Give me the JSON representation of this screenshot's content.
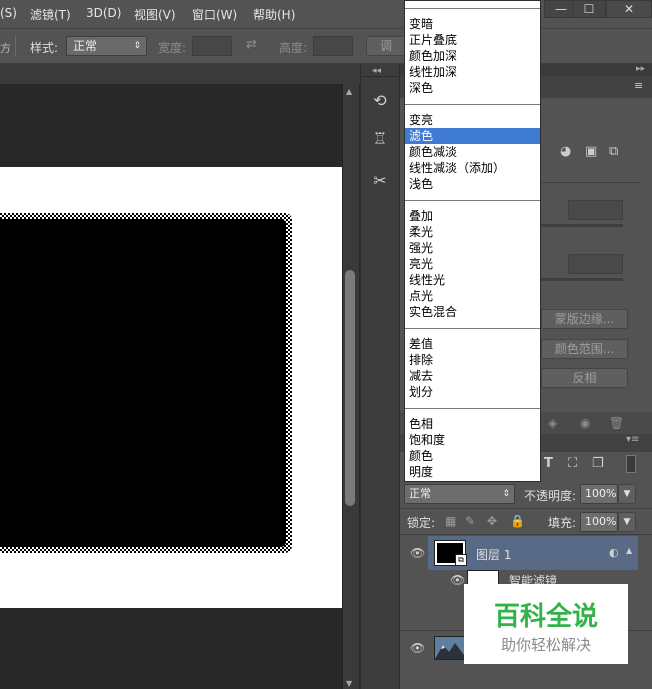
{
  "menubar": {
    "items": [
      "(S)",
      "滤镜(T)",
      "3D(D)",
      "视图(V)",
      "窗口(W)",
      "帮助(H)"
    ],
    "window_buttons": [
      "—",
      "☐",
      "✕"
    ]
  },
  "options": {
    "style_label": "样式:",
    "style_value": "正常",
    "width_label": "宽度:",
    "height_label": "高度:",
    "adjust_label": "调"
  },
  "blend_modes": {
    "groups": [
      [
        "变暗",
        "正片叠底",
        "颜色加深",
        "线性加深",
        "深色"
      ],
      [
        "变亮",
        "滤色",
        "颜色减淡",
        "线性减淡（添加）",
        "浅色"
      ],
      [
        "叠加",
        "柔光",
        "强光",
        "亮光",
        "线性光",
        "点光",
        "实色混合"
      ],
      [
        "差值",
        "排除",
        "减去",
        "划分"
      ],
      [
        "色相",
        "饱和度",
        "颜色",
        "明度"
      ]
    ],
    "selected": "滤色"
  },
  "properties": {
    "mask_edge_button": "蒙版边缘...",
    "color_range_button": "颜色范围...",
    "invert_button": "反相"
  },
  "layers": {
    "blend_value": "正常",
    "opacity_label": "不透明度:",
    "opacity_value": "100%",
    "lock_label": "锁定:",
    "fill_label": "填充:",
    "fill_value": "100%",
    "layer1_name": "图层 1",
    "smart_filter_label": "智能滤镜"
  },
  "watermark": {
    "title": "百科全说",
    "subtitle": "助你轻松解决"
  },
  "colors": {
    "selection_highlight": "#3f7ad3",
    "watermark_green": "#33b24a",
    "layer_selected": "#596a86"
  }
}
